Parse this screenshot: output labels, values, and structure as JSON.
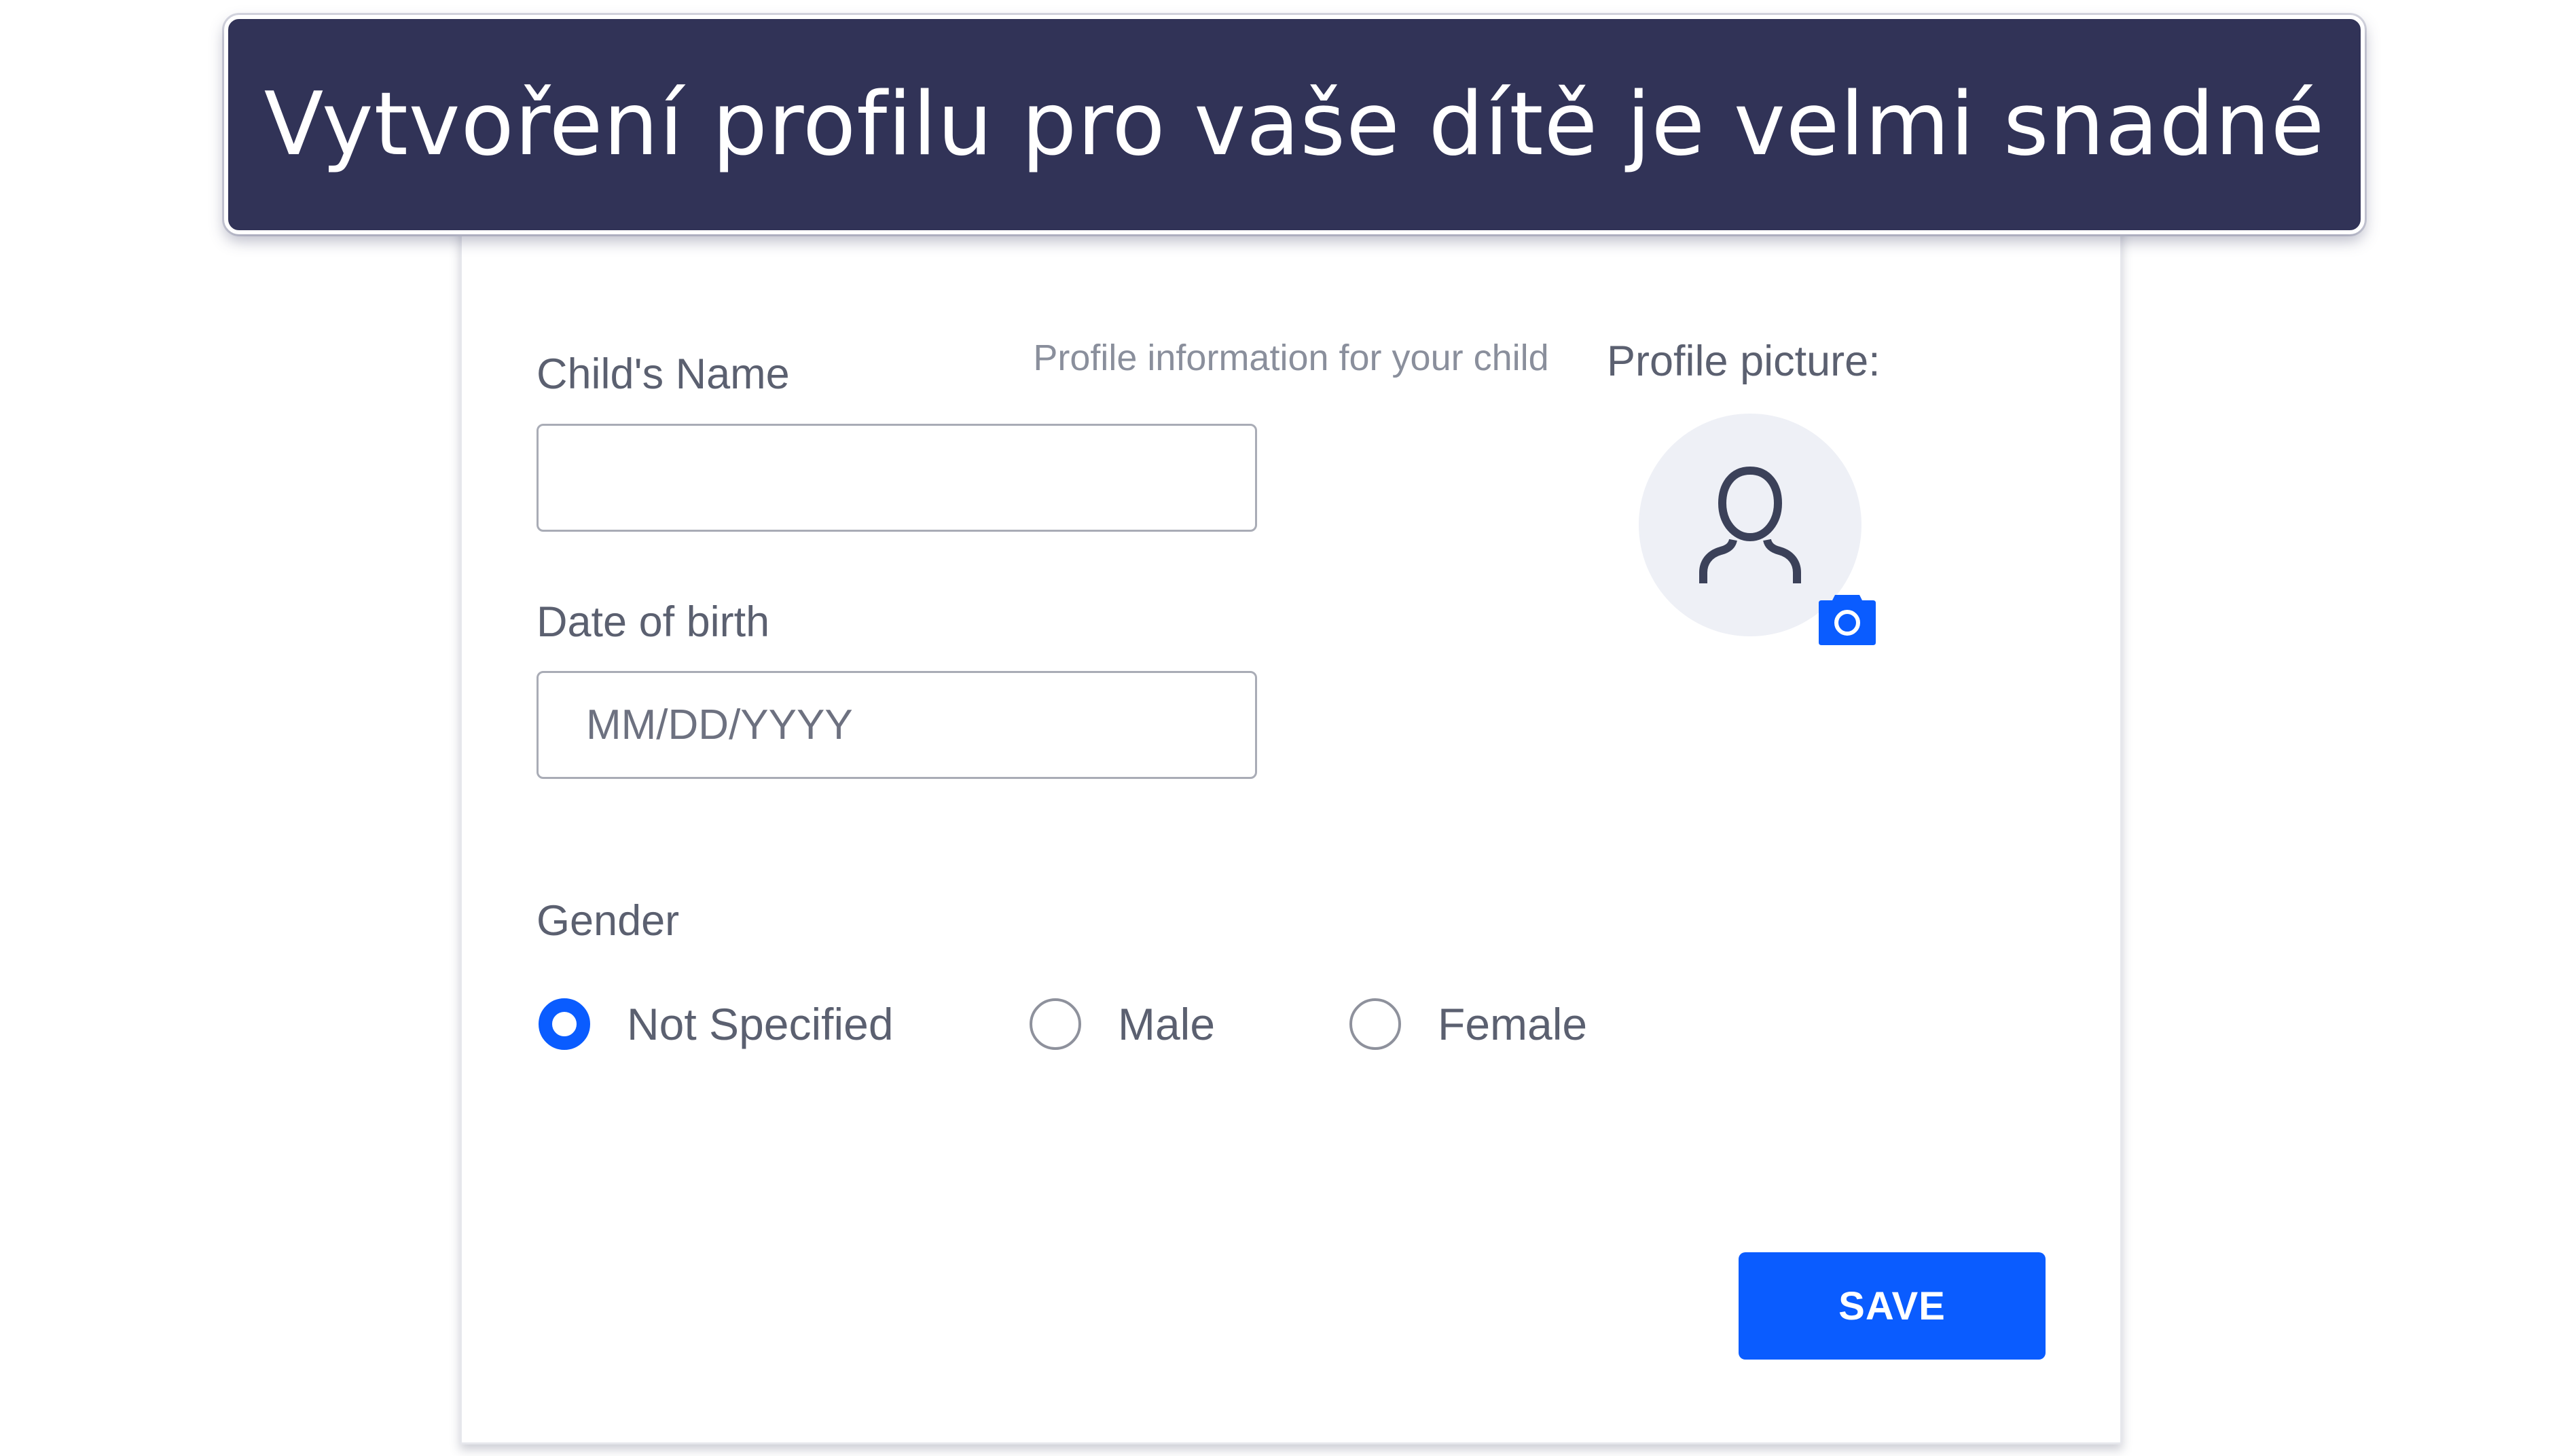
{
  "banner": {
    "title": "Vytvoření profilu pro vaše dítě je velmi snadné"
  },
  "form": {
    "subtitle": "Profile information for your child",
    "child_name": {
      "label": "Child's Name",
      "value": "",
      "placeholder": ""
    },
    "date_of_birth": {
      "label": "Date of birth",
      "value": "",
      "placeholder": "MM/DD/YYYY"
    },
    "gender": {
      "label": "Gender",
      "selected": "Not Specified",
      "options": [
        {
          "label": "Not Specified",
          "checked": true
        },
        {
          "label": "Male",
          "checked": false
        },
        {
          "label": "Female",
          "checked": false
        }
      ]
    },
    "profile_picture": {
      "label": "Profile picture:",
      "avatar_icon": "user-outline-icon",
      "upload_icon": "camera-icon"
    },
    "save_label": "SAVE"
  },
  "colors": {
    "banner_bg": "#313357",
    "accent": "#0a5cff",
    "avatar_bg": "#eef0f6",
    "label_text": "#5b6070"
  }
}
